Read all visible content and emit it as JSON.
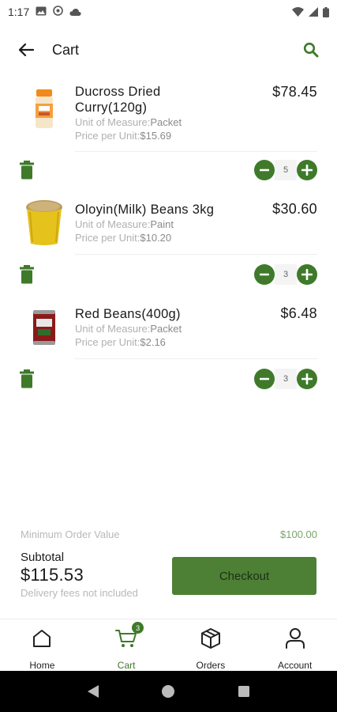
{
  "status_bar": {
    "time": "1:17"
  },
  "app_bar": {
    "title": "Cart"
  },
  "cart": {
    "items": [
      {
        "name": "Ducross Dried Curry(120g)",
        "uom_label": "Unit of Measure:",
        "uom_value": "Packet",
        "ppu_label": "Price per Unit:",
        "ppu_value": "$15.69",
        "price": "$78.45",
        "quantity": "5",
        "image": "spice-jar-icon"
      },
      {
        "name": "Oloyin(Milk) Beans 3kg",
        "uom_label": "Unit of Measure:",
        "uom_value": "Paint",
        "ppu_label": "Price per Unit:",
        "ppu_value": "$10.20",
        "price": "$30.60",
        "quantity": "3",
        "image": "bean-bucket-icon"
      },
      {
        "name": "Red Beans(400g)",
        "uom_label": "Unit of Measure:",
        "uom_value": "Packet",
        "ppu_label": "Price per Unit:",
        "ppu_value": "$2.16",
        "price": "$6.48",
        "quantity": "3",
        "image": "tin-can-icon"
      }
    ]
  },
  "summary": {
    "min_order_label": "Minimum Order Value",
    "min_order_value": "$100.00",
    "subtotal_label": "Subtotal",
    "subtotal_value": "$115.53",
    "delivery_note": "Delivery fees not included",
    "checkout_label": "Checkout"
  },
  "bottom_nav": {
    "items": [
      {
        "label": "Home",
        "icon": "home-icon"
      },
      {
        "label": "Cart",
        "icon": "cart-icon",
        "badge": "3",
        "active": true
      },
      {
        "label": "Orders",
        "icon": "package-icon"
      },
      {
        "label": "Account",
        "icon": "user-icon"
      }
    ]
  },
  "colors": {
    "accent": "#3f7a2a",
    "checkout_bg": "#4d8035",
    "muted_text": "#b0b0b0"
  }
}
